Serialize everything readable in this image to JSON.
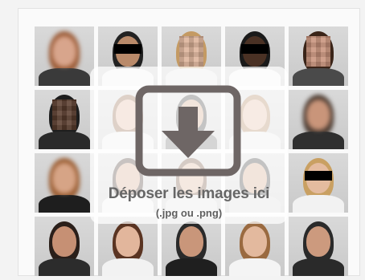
{
  "dropzone": {
    "title": "Déposer les images ici",
    "hint": "(.jpg ou .png)",
    "icon": "download-arrow-icon"
  },
  "colors": {
    "icon": "#6e6665",
    "text": "#666666"
  },
  "photos": [
    {
      "name": "photo-woman-blurred",
      "skin": "#d8a58c",
      "hair": "#9a5a35",
      "clothes": "#3a3a3a",
      "style": "blur",
      "bar": false
    },
    {
      "name": "photo-man-censored",
      "skin": "#b98a6a",
      "hair": "#222222",
      "clothes": "#f0f0f0",
      "style": "plain",
      "bar": true
    },
    {
      "name": "photo-woman-pixelated",
      "skin": "#dcb298",
      "hair": "#c49a63",
      "clothes": "#e6e6e6",
      "style": "pix",
      "bar": false
    },
    {
      "name": "photo-man-censored",
      "skin": "#4a3124",
      "hair": "#1a1a1a",
      "clothes": "#f4f4f4",
      "style": "plain",
      "bar": true
    },
    {
      "name": "photo-woman-pixelated",
      "skin": "#c8927a",
      "hair": "#3a2418",
      "clothes": "#4a4a4a",
      "style": "pix",
      "bar": false
    },
    {
      "name": "photo-man-pixelated",
      "skin": "#5a3d2e",
      "hair": "#1e1e1e",
      "clothes": "#2a2a2a",
      "style": "pix",
      "bar": false
    },
    {
      "name": "photo-woman",
      "skin": "#e0b49a",
      "hair": "#8a5b3a",
      "clothes": "#ececec",
      "style": "plain",
      "bar": false
    },
    {
      "name": "photo-man",
      "skin": "#cfa081",
      "hair": "#2b2b2b",
      "clothes": "#6a6a6a",
      "style": "plain",
      "bar": false
    },
    {
      "name": "photo-woman",
      "skin": "#e2b79d",
      "hair": "#a87a4f",
      "clothes": "#e8e8e8",
      "style": "plain",
      "bar": false
    },
    {
      "name": "photo-man-blurred",
      "skin": "#c9957a",
      "hair": "#4a3a30",
      "clothes": "#2f2f2f",
      "style": "blur",
      "bar": false
    },
    {
      "name": "photo-woman-blurred",
      "skin": "#d6a486",
      "hair": "#9a5d32",
      "clothes": "#1e1e1e",
      "style": "blur",
      "bar": false
    },
    {
      "name": "photo-man",
      "skin": "#d4a48a",
      "hair": "#3a2a22",
      "clothes": "#efefef",
      "style": "plain",
      "bar": false
    },
    {
      "name": "photo-woman",
      "skin": "#dab095",
      "hair": "#6a4530",
      "clothes": "#e0e0e0",
      "style": "plain",
      "bar": false
    },
    {
      "name": "photo-man",
      "skin": "#cfa083",
      "hair": "#2a2a2a",
      "clothes": "#d8d8d8",
      "style": "plain",
      "bar": false
    },
    {
      "name": "photo-woman-censored",
      "skin": "#e4bb9f",
      "hair": "#c9a062",
      "clothes": "#f2f2f2",
      "style": "plain",
      "bar": true
    },
    {
      "name": "photo-man",
      "skin": "#c69074",
      "hair": "#2a1f1a",
      "clothes": "#2c2c2c",
      "style": "plain",
      "bar": false
    },
    {
      "name": "photo-woman",
      "skin": "#e2b69c",
      "hair": "#5a3422",
      "clothes": "#f2f2f2",
      "style": "plain",
      "bar": false
    },
    {
      "name": "photo-man",
      "skin": "#c9967a",
      "hair": "#2a2a2a",
      "clothes": "#1f1f1f",
      "style": "plain",
      "bar": false
    },
    {
      "name": "photo-woman",
      "skin": "#e3b99e",
      "hair": "#9a6a40",
      "clothes": "#f4f4f4",
      "style": "plain",
      "bar": false
    },
    {
      "name": "photo-man",
      "skin": "#cc9a7e",
      "hair": "#2a2a2a",
      "clothes": "#2a2a2a",
      "style": "plain",
      "bar": false
    }
  ]
}
